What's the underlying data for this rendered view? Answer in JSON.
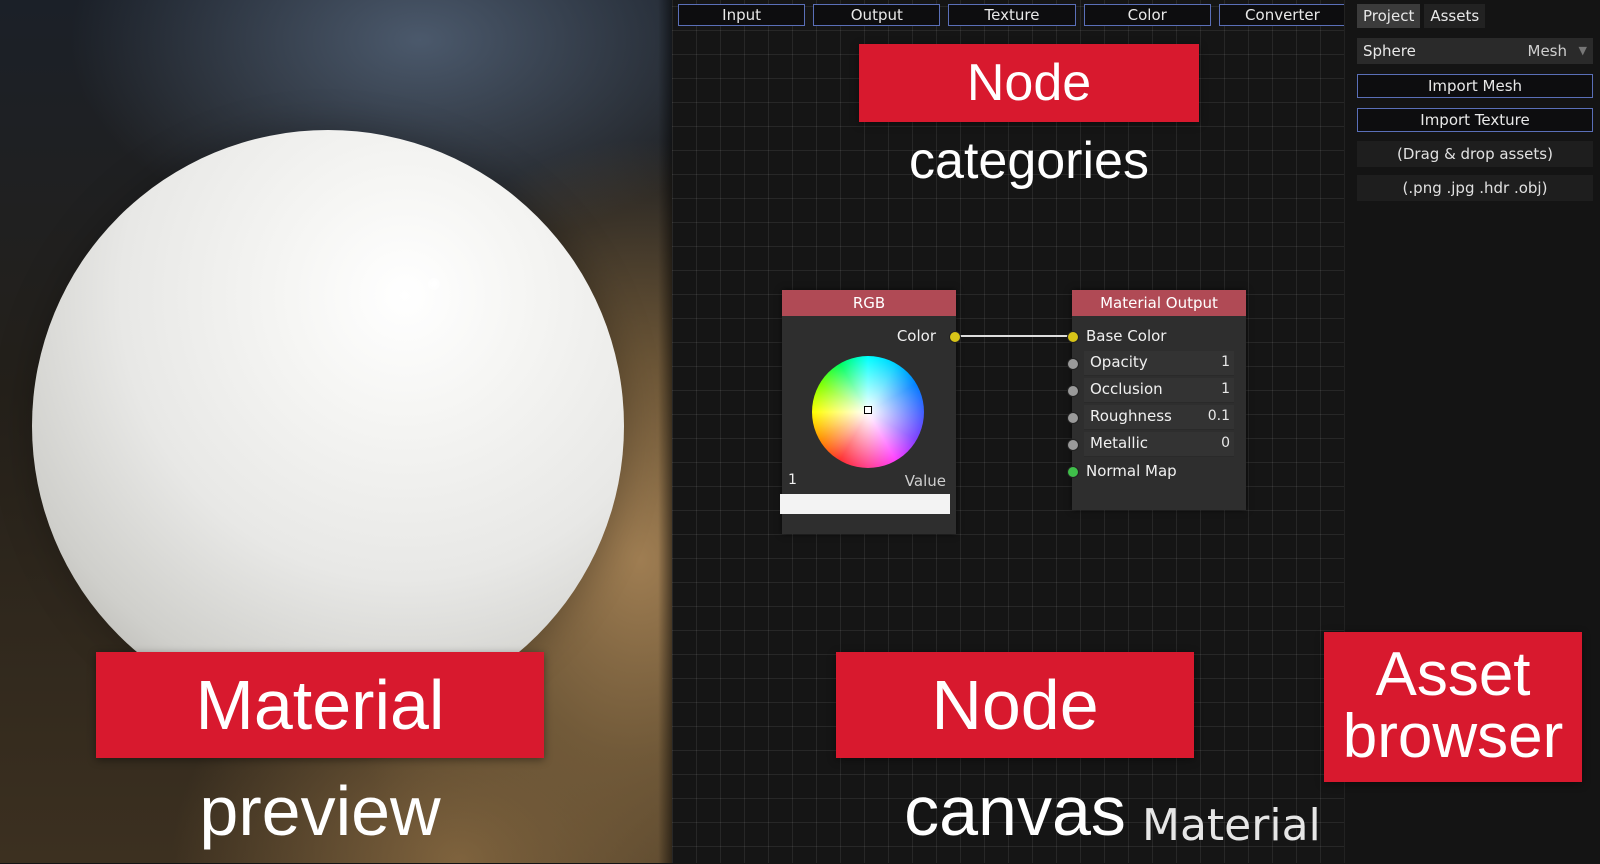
{
  "node_categories": [
    "Input",
    "Output",
    "Texture",
    "Color",
    "Converter"
  ],
  "rgb_node": {
    "title": "RGB",
    "output_label": "Color",
    "value_number": "1",
    "value_label": "Value"
  },
  "output_node": {
    "title": "Material Output",
    "inputs": [
      {
        "label": "Base Color",
        "value": "",
        "socket_color": "#d8c418"
      },
      {
        "label": "Opacity",
        "value": "1",
        "socket_color": "#9a9a9a"
      },
      {
        "label": "Occlusion",
        "value": "1",
        "socket_color": "#9a9a9a"
      },
      {
        "label": "Roughness",
        "value": "0.1",
        "socket_color": "#9a9a9a"
      },
      {
        "label": "Metallic",
        "value": "0",
        "socket_color": "#9a9a9a"
      },
      {
        "label": "Normal Map",
        "value": "",
        "socket_color": "#3fbf4a"
      }
    ]
  },
  "asset_browser": {
    "tabs": [
      "Project",
      "Assets"
    ],
    "mesh_select": {
      "value": "Sphere",
      "type": "Mesh"
    },
    "import_mesh_label": "Import Mesh",
    "import_texture_label": "Import Texture",
    "hint_drag": "(Drag & drop assets)",
    "hint_formats": "(.png .jpg .hdr .obj)"
  },
  "callouts": {
    "categories": "Node categories",
    "preview": "Material preview",
    "canvas": "Node canvas",
    "asset_browser": "Asset browser"
  },
  "canvas_label": "Material",
  "colors": {
    "callout_red": "#d8192e",
    "node_header": "#b04a55",
    "button_border": "#5a6fb8"
  }
}
